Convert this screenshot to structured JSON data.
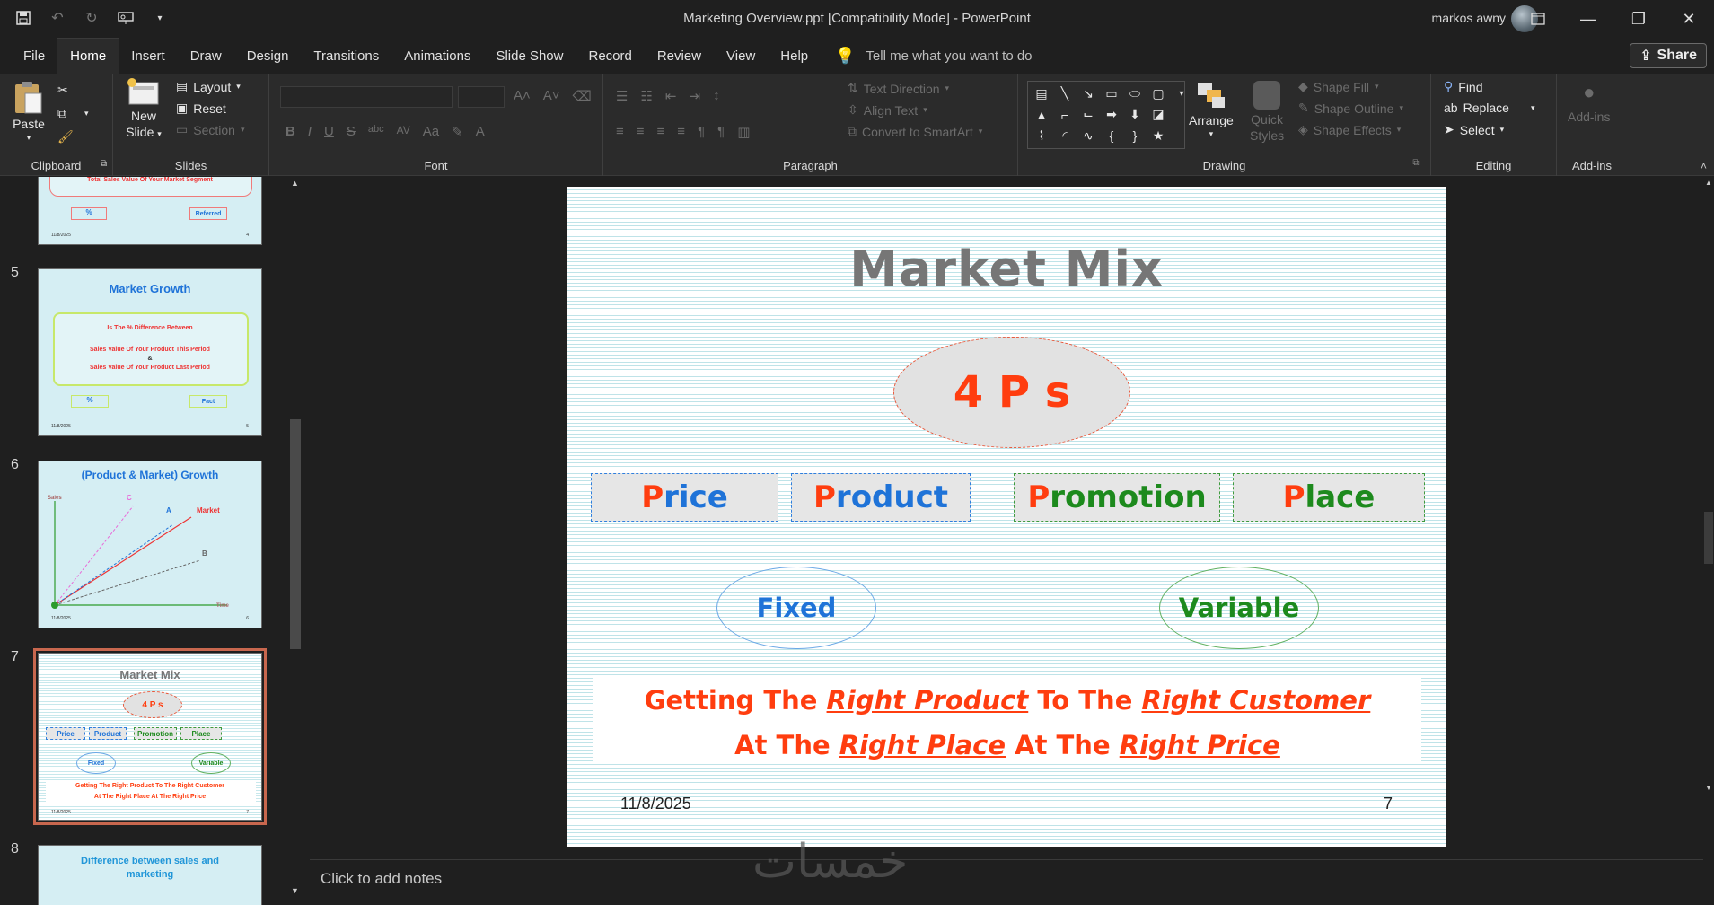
{
  "window": {
    "title": "Marketing Overview.ppt [Compatibility Mode]  -  PowerPoint",
    "user": "markos awny"
  },
  "menu": {
    "tabs": [
      "File",
      "Home",
      "Insert",
      "Draw",
      "Design",
      "Transitions",
      "Animations",
      "Slide Show",
      "Record",
      "Review",
      "View",
      "Help"
    ],
    "active": "Home",
    "tell_me": "Tell me what you want to do",
    "share": "Share"
  },
  "ribbon": {
    "clipboard": {
      "label": "Clipboard",
      "paste": "Paste"
    },
    "slides": {
      "label": "Slides",
      "new_slide_1": "New",
      "new_slide_2": "Slide",
      "layout": "Layout",
      "reset": "Reset",
      "section": "Section"
    },
    "font": {
      "label": "Font"
    },
    "paragraph": {
      "label": "Paragraph",
      "text_direction": "Text Direction",
      "align_text": "Align Text",
      "convert": "Convert to SmartArt"
    },
    "drawing": {
      "label": "Drawing",
      "arrange": "Arrange",
      "quick_styles_1": "Quick",
      "quick_styles_2": "Styles",
      "shape_fill": "Shape Fill",
      "shape_outline": "Shape Outline",
      "shape_effects": "Shape Effects"
    },
    "editing": {
      "label": "Editing",
      "find": "Find",
      "replace": "Replace",
      "select": "Select"
    },
    "addins": {
      "label": "Add-ins",
      "addins_btn": "Add-ins"
    }
  },
  "thumbnails": {
    "slide4": {
      "text": "Total Sales Value Of Your Market Segment",
      "pct": "%",
      "ref": "Referred",
      "date": "11/8/2025",
      "page": "4"
    },
    "slide5": {
      "num": "5",
      "title": "Market Growth",
      "l1": "Is The  %  Difference Between",
      "l2": "Sales Value Of Your Product This Period",
      "l3": "&",
      "l4": "Sales Value Of Your Product Last Period",
      "pct": "%",
      "fact": "Fact",
      "date": "11/8/2025",
      "page": "5"
    },
    "slide6": {
      "num": "6",
      "title": "(Product & Market) Growth",
      "sales": "Sales",
      "time": "Time",
      "market": "Market",
      "a": "A",
      "b": "B",
      "c": "C",
      "date": "11/8/2025",
      "page": "6"
    },
    "slide7": {
      "num": "7",
      "title": "Market Mix",
      "fourps": "4 P s",
      "price": "Price",
      "product": "Product",
      "promotion": "Promotion",
      "place": "Place",
      "fixed": "Fixed",
      "variable": "Variable",
      "t1": "Getting The Right Product To The Right Customer",
      "t2": "At The Right Place At The Right Price",
      "date": "11/8/2025",
      "page": "7"
    },
    "slide8": {
      "num": "8",
      "title": "Difference between sales and marketing"
    }
  },
  "slide": {
    "title": "Market Mix",
    "fourps": "4 P s",
    "price_first": "P",
    "price_rest": "rice",
    "product_first": "P",
    "product_rest": "roduct",
    "promotion_first": "P",
    "promotion_rest": "romotion",
    "place_first": "P",
    "place_rest": "lace",
    "fixed": "Fixed",
    "variable": "Variable",
    "line1": {
      "a": "Getting The ",
      "b": "Right Product",
      "c": " To The ",
      "d": "Right Customer"
    },
    "line2": {
      "a": "At The ",
      "b": "Right Place",
      "c": " At The ",
      "d": "Right Price"
    },
    "date": "11/8/2025",
    "page": "7"
  },
  "notes": {
    "placeholder": "Click to add notes"
  },
  "watermark": "خمسات",
  "colors": {
    "accent_red": "#ff3d0f",
    "blue": "#1f73d8",
    "green": "#1d8a1d",
    "title_gray": "#767676",
    "selection": "#c8674e"
  }
}
